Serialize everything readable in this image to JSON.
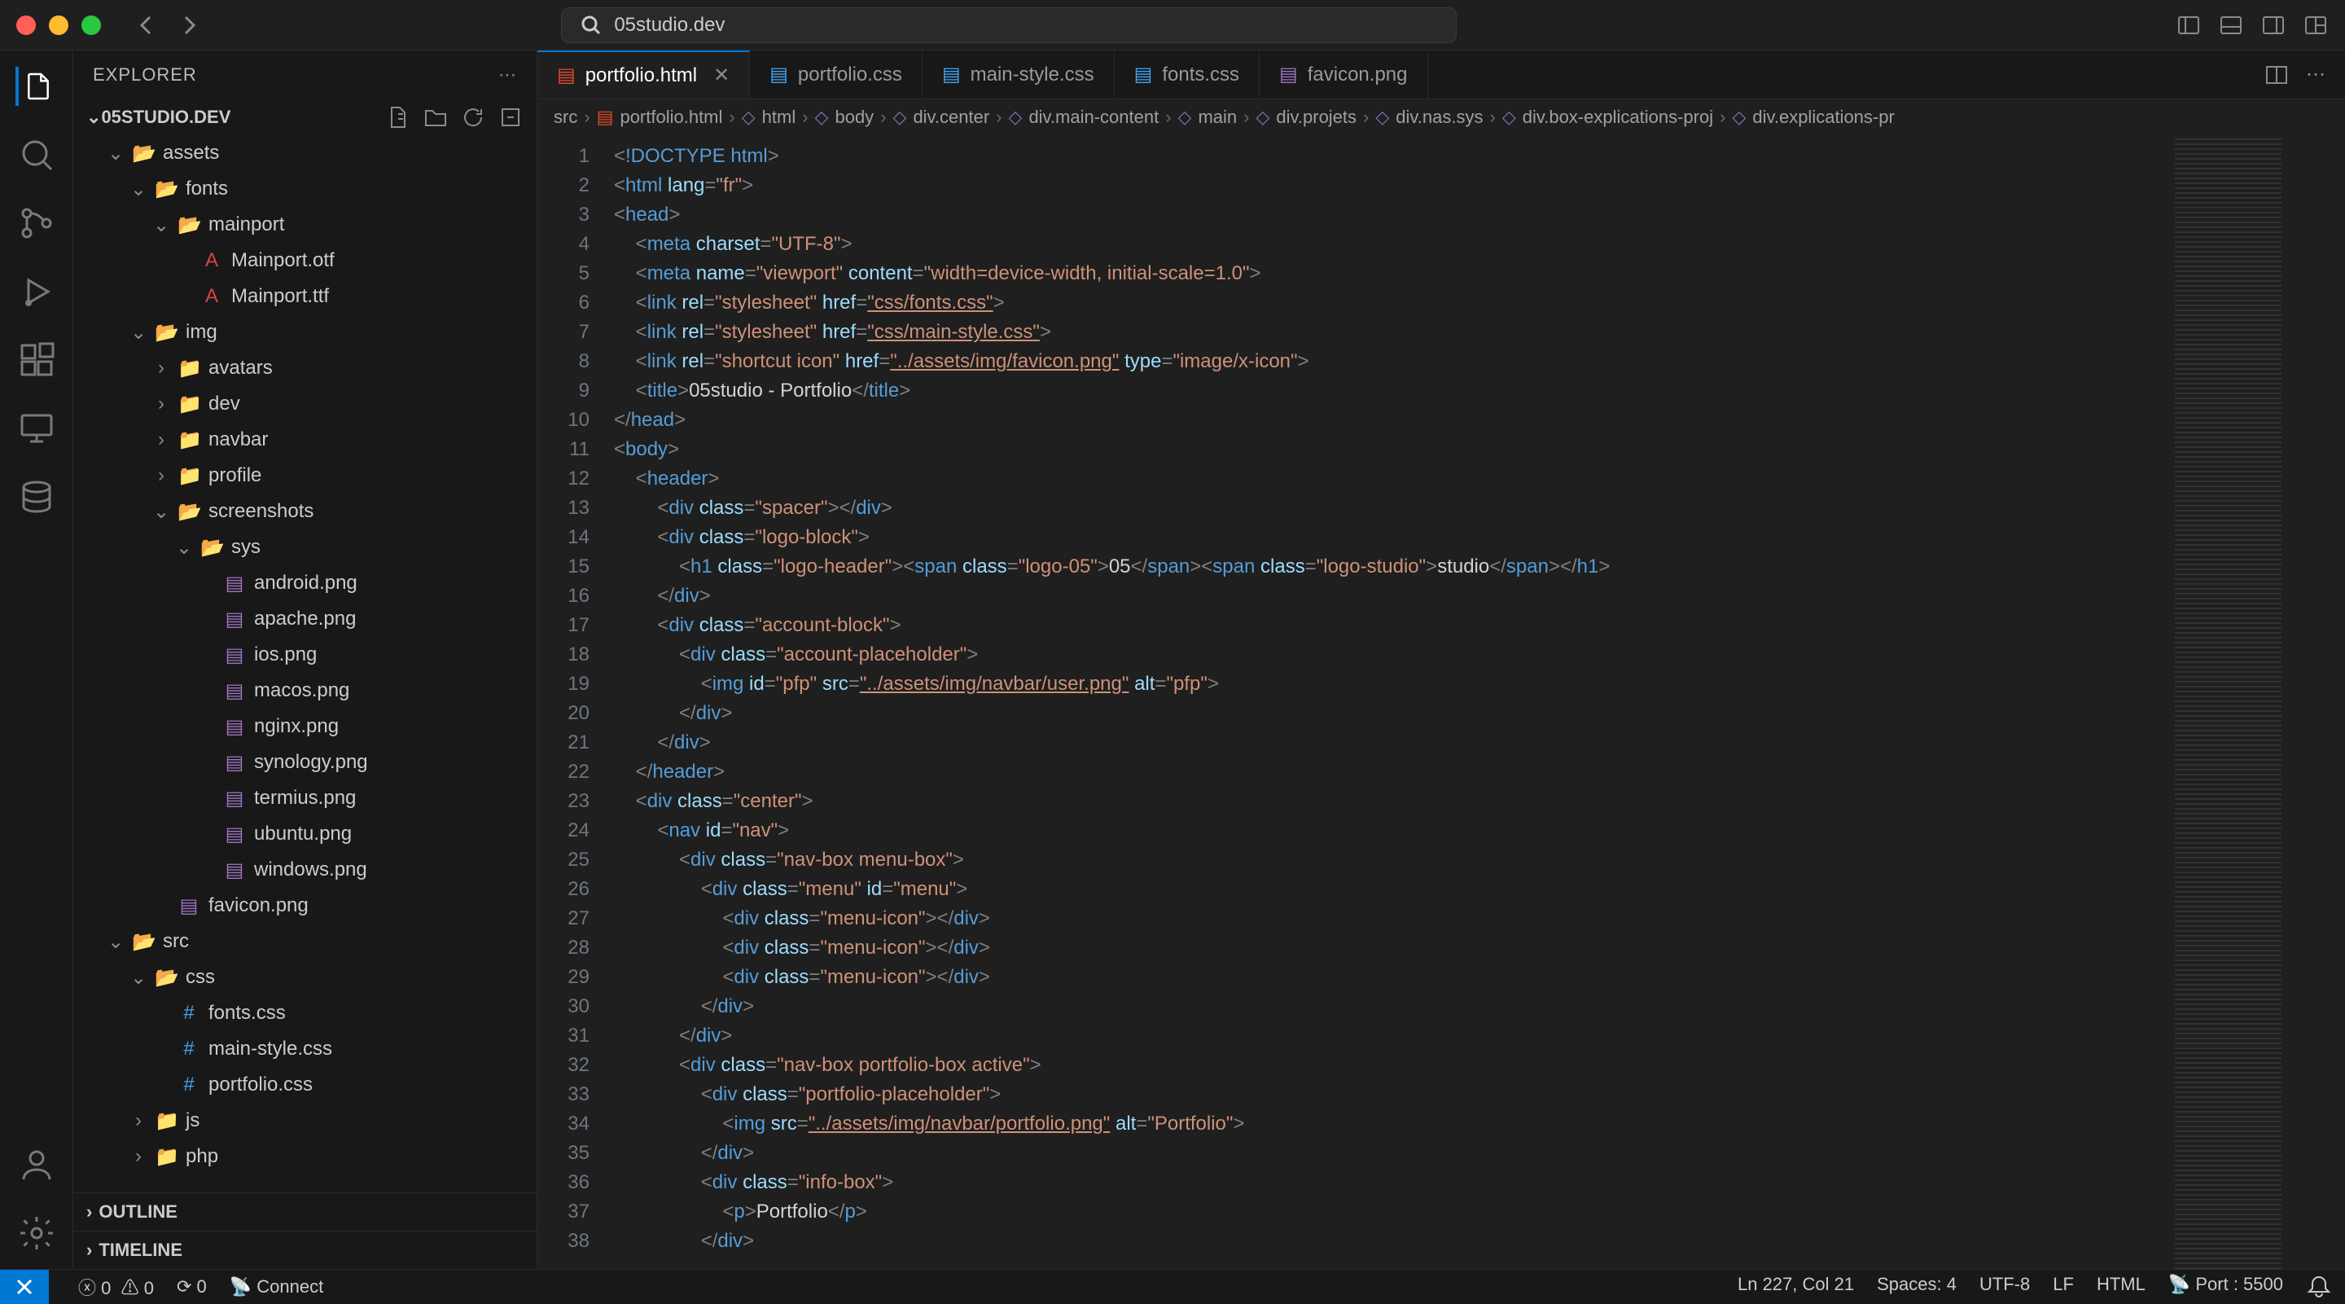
{
  "title": "05studio.dev",
  "tabs": [
    {
      "name": "portfolio.html",
      "icon": "html",
      "active": true,
      "close": true
    },
    {
      "name": "portfolio.css",
      "icon": "css",
      "active": false
    },
    {
      "name": "main-style.css",
      "icon": "css",
      "active": false
    },
    {
      "name": "fonts.css",
      "icon": "css",
      "active": false
    },
    {
      "name": "favicon.png",
      "icon": "img",
      "active": false
    }
  ],
  "explorer": {
    "title": "EXPLORER",
    "root": "05STUDIO.DEV",
    "items": [
      {
        "d": 1,
        "t": "folder-open",
        "n": "assets",
        "exp": true
      },
      {
        "d": 2,
        "t": "folder-open",
        "n": "fonts",
        "exp": true
      },
      {
        "d": 3,
        "t": "folder-open",
        "n": "mainport",
        "exp": true
      },
      {
        "d": 4,
        "t": "font",
        "n": "Mainport.otf"
      },
      {
        "d": 4,
        "t": "font",
        "n": "Mainport.ttf"
      },
      {
        "d": 2,
        "t": "folder-open",
        "n": "img",
        "exp": true
      },
      {
        "d": 3,
        "t": "folder",
        "n": "avatars",
        "exp": false
      },
      {
        "d": 3,
        "t": "folder",
        "n": "dev",
        "exp": false
      },
      {
        "d": 3,
        "t": "folder",
        "n": "navbar",
        "exp": false
      },
      {
        "d": 3,
        "t": "folder",
        "n": "profile",
        "exp": false
      },
      {
        "d": 3,
        "t": "folder-open",
        "n": "screenshots",
        "exp": true
      },
      {
        "d": 4,
        "t": "folder-open",
        "n": "sys",
        "exp": true
      },
      {
        "d": 5,
        "t": "img",
        "n": "android.png"
      },
      {
        "d": 5,
        "t": "img",
        "n": "apache.png"
      },
      {
        "d": 5,
        "t": "img",
        "n": "ios.png"
      },
      {
        "d": 5,
        "t": "img",
        "n": "macos.png"
      },
      {
        "d": 5,
        "t": "img",
        "n": "nginx.png"
      },
      {
        "d": 5,
        "t": "img",
        "n": "synology.png"
      },
      {
        "d": 5,
        "t": "img",
        "n": "termius.png"
      },
      {
        "d": 5,
        "t": "img",
        "n": "ubuntu.png"
      },
      {
        "d": 5,
        "t": "img",
        "n": "windows.png"
      },
      {
        "d": 3,
        "t": "img",
        "n": "favicon.png"
      },
      {
        "d": 1,
        "t": "folder-open",
        "n": "src",
        "exp": true
      },
      {
        "d": 2,
        "t": "folder-open",
        "n": "css",
        "exp": true
      },
      {
        "d": 3,
        "t": "css",
        "n": "fonts.css"
      },
      {
        "d": 3,
        "t": "css",
        "n": "main-style.css"
      },
      {
        "d": 3,
        "t": "css",
        "n": "portfolio.css"
      },
      {
        "d": 2,
        "t": "folder",
        "n": "js",
        "exp": false
      },
      {
        "d": 2,
        "t": "folder",
        "n": "php",
        "exp": false
      }
    ],
    "outline": "OUTLINE",
    "timeline": "TIMELINE"
  },
  "breadcrumb": [
    "src",
    "portfolio.html",
    "html",
    "body",
    "div.center",
    "div.main-content",
    "main",
    "div.projets",
    "div.nas.sys",
    "div.box-explications-proj",
    "div.explications-pr"
  ],
  "code_lines": [
    "<!DOCTYPE html>",
    "<html lang=\"fr\">",
    "<head>",
    "    <meta charset=\"UTF-8\">",
    "    <meta name=\"viewport\" content=\"width=device-width, initial-scale=1.0\">",
    "    <link rel=\"stylesheet\" href=\"css/fonts.css\">",
    "    <link rel=\"stylesheet\" href=\"css/main-style.css\">",
    "    <link rel=\"shortcut icon\" href=\"../assets/img/favicon.png\" type=\"image/x-icon\">",
    "    <title>05studio - Portfolio</title>",
    "</head>",
    "<body>",
    "    <header>",
    "        <div class=\"spacer\"></div>",
    "        <div class=\"logo-block\">",
    "            <h1 class=\"logo-header\"><span class=\"logo-05\">05</span><span class=\"logo-studio\">studio</span></h1>",
    "        </div>",
    "        <div class=\"account-block\">",
    "            <div class=\"account-placeholder\">",
    "                <img id=\"pfp\" src=\"../assets/img/navbar/user.png\" alt=\"pfp\">",
    "            </div>",
    "        </div>",
    "    </header>",
    "    <div class=\"center\">",
    "        <nav id=\"nav\">",
    "            <div class=\"nav-box menu-box\">",
    "                <div class=\"menu\" id=\"menu\">",
    "                    <div class=\"menu-icon\"></div>",
    "                    <div class=\"menu-icon\"></div>",
    "                    <div class=\"menu-icon\"></div>",
    "                </div>",
    "            </div>",
    "            <div class=\"nav-box portfolio-box active\">",
    "                <div class=\"portfolio-placeholder\">",
    "                    <img src=\"../assets/img/navbar/portfolio.png\" alt=\"Portfolio\">",
    "                </div>",
    "                <div class=\"info-box\">",
    "                    <p>Portfolio</p>",
    "                </div>"
  ],
  "status": {
    "errors": "0",
    "warnings": "0",
    "ports_fwd": "0",
    "connect": "Connect",
    "ln_col": "Ln 227, Col 21",
    "spaces": "Spaces: 4",
    "enc": "UTF-8",
    "eol": "LF",
    "lang": "HTML",
    "port": "Port : 5500"
  }
}
